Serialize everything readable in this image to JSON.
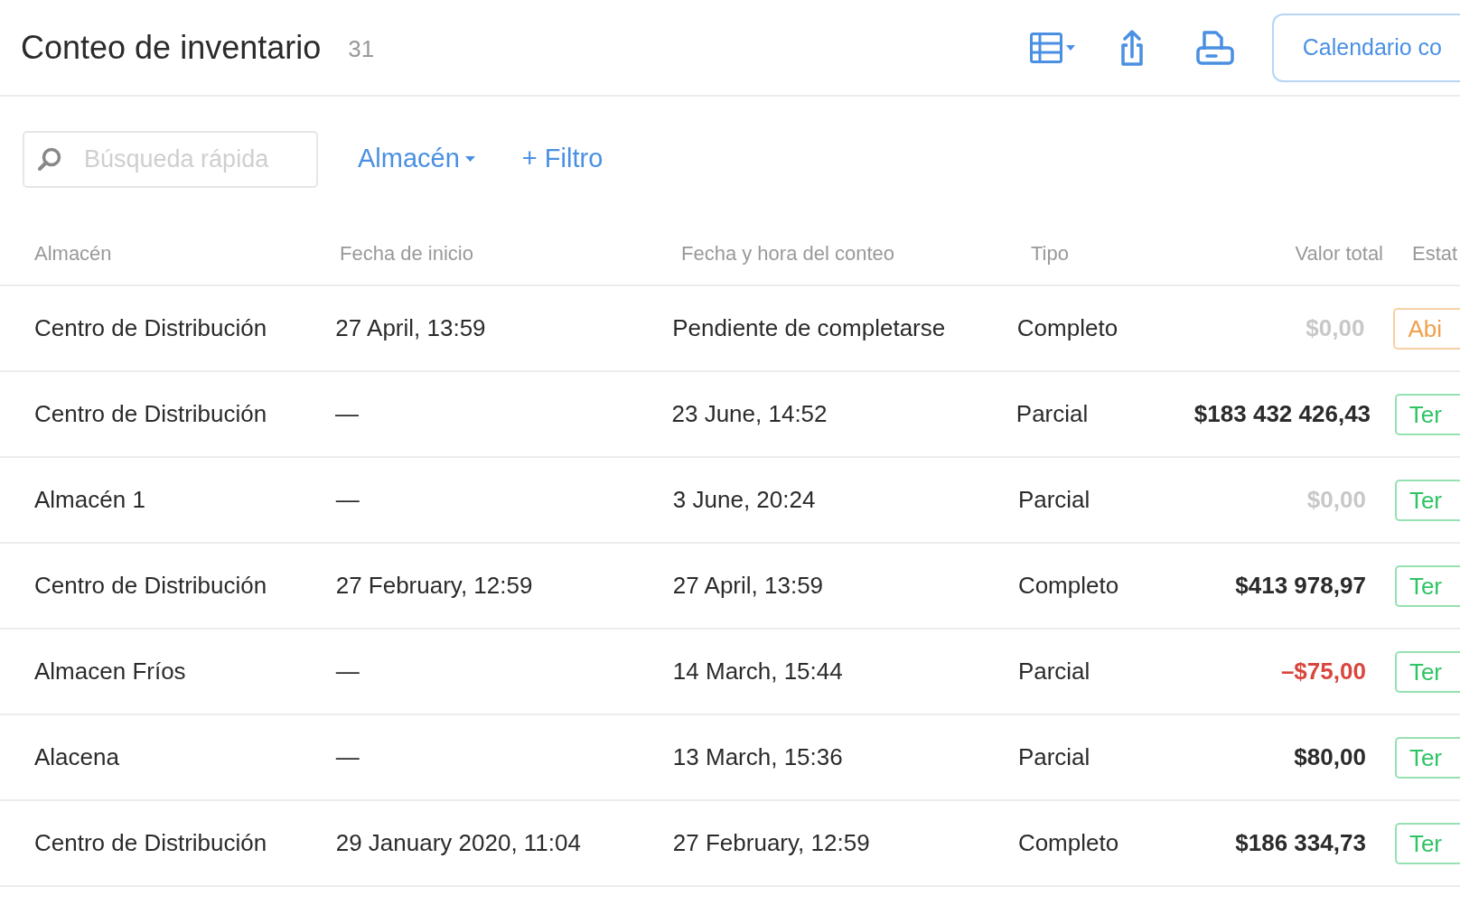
{
  "header": {
    "title": "Conteo de inventario",
    "count": "31",
    "calendar_button": "Calendario co"
  },
  "toolbar": {
    "search": {
      "placeholder": "Búsqueda rápida"
    },
    "warehouse_filter": "Almacén",
    "add_filter": "+ Filtro"
  },
  "table": {
    "columns": [
      "Almacén",
      "Fecha de inicio",
      "Fecha y hora del conteo",
      "Tipo",
      "Valor total",
      "Estat"
    ],
    "rows": [
      {
        "warehouse": "Centro de Distribución",
        "start": "27 April, 13:59",
        "counted": "Pendiente de completarse",
        "type": "Completo",
        "value": "$0,00",
        "kind": "zero",
        "status": "Abi",
        "color": "#f0a04b"
      },
      {
        "warehouse": "Centro de Distribución",
        "start": "—",
        "counted": "23 June, 14:52",
        "type": "Parcial",
        "value": "$183 432 426,43",
        "kind": "positive",
        "status": "Ter",
        "color": "#2ec464"
      },
      {
        "warehouse": "Almacén 1",
        "start": "—",
        "counted": "3 June, 20:24",
        "type": "Parcial",
        "value": "$0,00",
        "kind": "zero",
        "status": "Ter",
        "color": "#2ec464"
      },
      {
        "warehouse": "Centro de Distribución",
        "start": "27 February, 12:59",
        "counted": "27 April, 13:59",
        "type": "Completo",
        "value": "$413 978,97",
        "kind": "positive",
        "status": "Ter",
        "color": "#2ec464"
      },
      {
        "warehouse": "Almacen Fríos",
        "start": "—",
        "counted": "14 March, 15:44",
        "type": "Parcial",
        "value": "–$75,00",
        "kind": "negative",
        "status": "Ter",
        "color": "#2ec464"
      },
      {
        "warehouse": "Alacena",
        "start": "—",
        "counted": "13 March, 15:36",
        "type": "Parcial",
        "value": "$80,00",
        "kind": "positive",
        "status": "Ter",
        "color": "#2ec464"
      },
      {
        "warehouse": "Centro de Distribución",
        "start": "29 January 2020, 11:04",
        "counted": "27 February, 12:59",
        "type": "Completo",
        "value": "$186 334,73",
        "kind": "positive",
        "status": "Ter",
        "color": "#2ec464"
      }
    ]
  }
}
